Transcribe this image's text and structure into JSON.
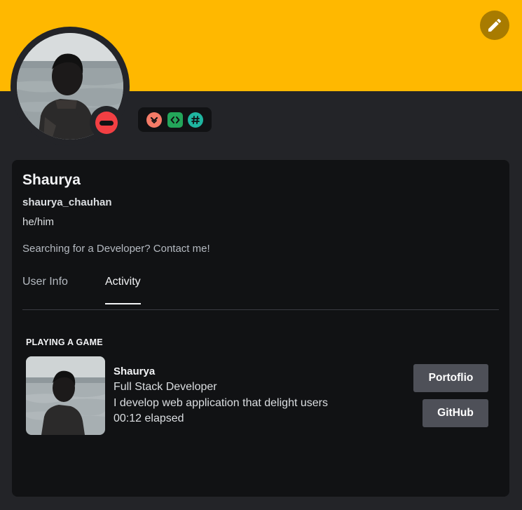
{
  "profile": {
    "display_name": "Shaurya",
    "username": "shaurya_chauhan",
    "pronouns": "he/him",
    "bio": "Searching for a Developer? Contact me!",
    "status": "do-not-disturb",
    "banner_color": "#ffb800",
    "status_color": "#f23f43"
  },
  "header": {
    "edit_icon": "pencil-icon"
  },
  "badges": [
    {
      "icon": "nitro-chevron-icon",
      "color": "#f47b67"
    },
    {
      "icon": "active-developer-icon",
      "color": "#23a55a"
    },
    {
      "icon": "hashtag-icon",
      "color": "#1fb5a0"
    }
  ],
  "tabs": [
    {
      "label": "User Info",
      "active": false
    },
    {
      "label": "Activity",
      "active": true
    }
  ],
  "activity": {
    "heading": "PLAYING A GAME",
    "name": "Shaurya",
    "details": "Full Stack Developer",
    "state": "I develop web application that delight users",
    "elapsed": "00:12 elapsed",
    "buttons": [
      {
        "label": "Portoflio"
      },
      {
        "label": "GitHub"
      }
    ]
  }
}
